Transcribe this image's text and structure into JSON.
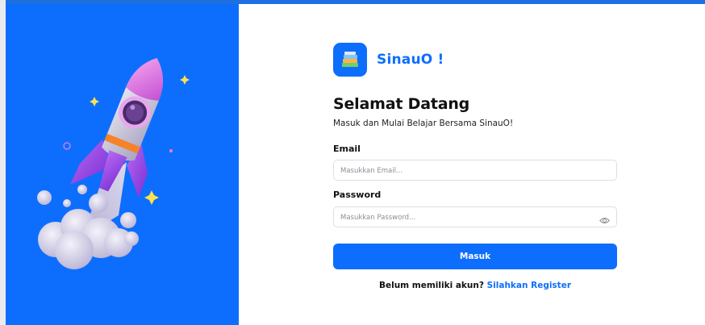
{
  "brand": {
    "name": "SinauO !",
    "logo_icon": "books-icon"
  },
  "login": {
    "title": "Selamat Datang",
    "subtitle": "Masuk dan Mulai Belajar Bersama SinauO!",
    "email_label": "Email",
    "email_placeholder": "Masukkan Email...",
    "password_label": "Password",
    "password_placeholder": "Masukkan Password...",
    "submit_label": "Masuk",
    "register_prompt": "Belum memiliki akun?",
    "register_link": "Silahkan Register"
  },
  "icons": {
    "password_toggle": "eye-icon",
    "hero": "rocket-illustration"
  },
  "colors": {
    "primary": "#0d6efd",
    "hero_bg": "#0d6efd",
    "text": "#111111"
  }
}
